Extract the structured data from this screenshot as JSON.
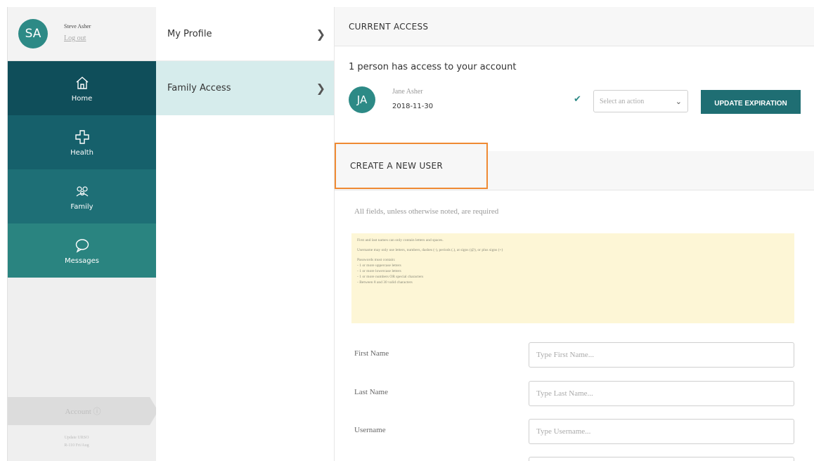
{
  "user": {
    "initials": "SA",
    "name": "Steve Asher",
    "logout_label": "Log out"
  },
  "nav": {
    "items": [
      {
        "label": "Home",
        "icon": "home-icon"
      },
      {
        "label": "Health",
        "icon": "health-cross-icon"
      },
      {
        "label": "Family",
        "icon": "family-icon"
      },
      {
        "label": "Messages",
        "icon": "chat-bubble-icon"
      }
    ],
    "account_label": "Account ⓘ",
    "footer_line1": "Update URSO",
    "footer_line2": "R-110 Fri/Aug"
  },
  "settings_menu": {
    "items": [
      {
        "label": "My Profile",
        "active": false
      },
      {
        "label": "Family Access",
        "active": true
      }
    ]
  },
  "current_access": {
    "heading": "CURRENT ACCESS",
    "summary": "1 person has access to your account",
    "person": {
      "initials": "JA",
      "name": "Jane Asher",
      "date": "2018-11-30"
    },
    "action_placeholder": "Select an action",
    "update_button": "UPDATE EXPIRATION"
  },
  "create_user": {
    "heading": "CREATE A NEW USER",
    "required_note": "All fields, unless otherwise noted, are required",
    "rules": {
      "names": "First and last names can only contain letters and spaces.",
      "username": "Username may only use letters, numbers, dashes (-), periods (.), at signs (@), or plus signs (+)",
      "password_intro": "Passwords must contain:",
      "password_rules": [
        "- 1 or more uppercase letters",
        "- 1 or more lowercase letters",
        "- 1 or more numbers OR special characters",
        "- Between 8 and 30 valid characters"
      ]
    },
    "fields": [
      {
        "label": "First Name",
        "placeholder": "Type First Name..."
      },
      {
        "label": "Last Name",
        "placeholder": "Type Last Name..."
      },
      {
        "label": "Username",
        "placeholder": "Type Username..."
      }
    ]
  },
  "colors": {
    "nav_home": "#0f4e5a",
    "nav_health": "#16606b",
    "nav_family": "#1e6f76",
    "nav_messages": "#2a8480",
    "accent": "#2d8a86",
    "active_menu": "#d6ecec",
    "highlight_border": "#ef8a33",
    "info_bg": "#fdf6d6"
  }
}
